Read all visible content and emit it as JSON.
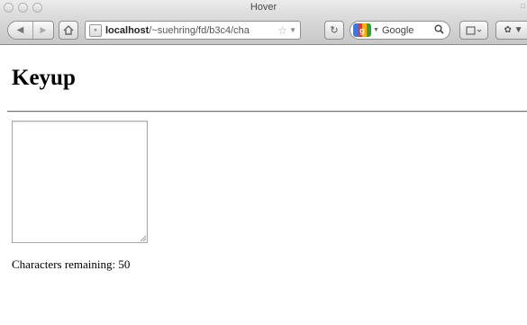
{
  "window": {
    "title": "Hover"
  },
  "toolbar": {
    "url_host": "localhost",
    "url_path": "/~suehring/fd/b3c4/cha",
    "search_engine": "Google",
    "icons": [
      "back-icon",
      "forward-icon",
      "home-icon",
      "site-icon",
      "star-icon",
      "reload-icon",
      "google-icon",
      "search-icon",
      "bookmarks-icon",
      "addon-icon"
    ]
  },
  "page": {
    "heading": "Keyup",
    "textarea_value": "",
    "remaining_label": "Characters remaining: 50"
  }
}
